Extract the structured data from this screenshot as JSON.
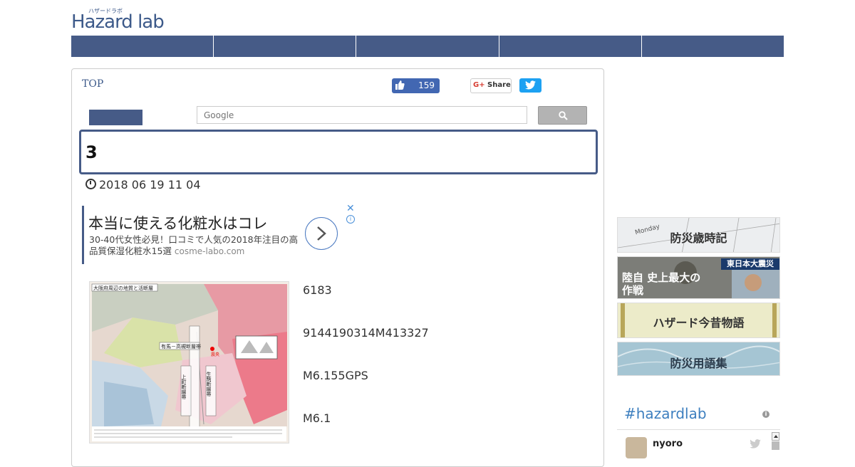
{
  "header": {
    "logo_text": "Hazard lab",
    "logo_kana": "ハザードラボ",
    "nav_items": [
      "",
      "",
      "",
      "",
      ""
    ]
  },
  "breadcrumb": "TOP",
  "social": {
    "like_count": "159",
    "gplus_label": "Share",
    "gplus_glyph": "G+"
  },
  "search": {
    "placeholder": "Google"
  },
  "article": {
    "title": "3",
    "date": "2018  06  19   11  04",
    "paragraphs": [
      "6183",
      "9144190314M413327",
      "M6.155GPS",
      "M6.1"
    ]
  },
  "ad": {
    "title": "本当に使える化粧水はコレ",
    "sub": "30-40代女性必見！口コミで人気の2018年注目の高品質保湿化粧水15選",
    "domain": "cosme-labo.com",
    "close": "✕",
    "info": "i"
  },
  "map_figure": {
    "title": "大阪府周辺の地質と活断層",
    "labels": [
      "有馬－高槻断層帯",
      "上町断層帯",
      "生駒断層帯",
      "震央"
    ]
  },
  "sidebar": {
    "banners": [
      {
        "label": "防災歳時記",
        "extra": "Monday"
      },
      {
        "label": "陸自 史上最大の作戦",
        "extra": "東日本大震災"
      },
      {
        "label": "ハザード今昔物語",
        "extra": ""
      },
      {
        "label": "防災用語集",
        "extra": ""
      }
    ],
    "hashtag": "#hazardlab",
    "feed_user": "nyoro",
    "info_glyph": "i"
  },
  "colors": {
    "nav": "#465b87",
    "facebook": "#4267b2",
    "twitter": "#1da1f2",
    "hashtag": "#3d7fbf"
  }
}
